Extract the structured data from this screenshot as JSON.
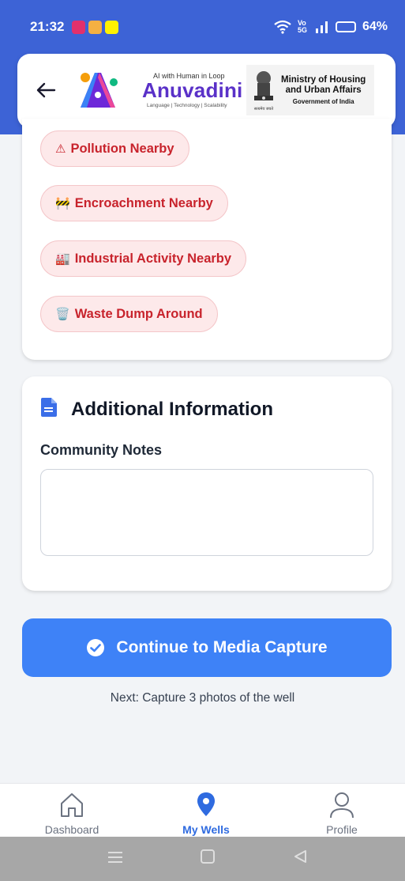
{
  "status_bar": {
    "time": "21:32",
    "apps": [
      "instagram-icon",
      "box-icon",
      "snapchat-icon"
    ],
    "network": "Vo 5G",
    "battery": "64%"
  },
  "header": {
    "back_icon": "arrow-left-icon",
    "brand_tagline": "AI with Human in Loop",
    "brand_name": "Anuvadini",
    "brand_sub": "Language | Technology | Scalability",
    "ministry_line1": "Ministry of Housing",
    "ministry_line2": "and Urban Affairs",
    "ministry_line3": "Government of India",
    "emblem_caption": "सत्यमेव जयते"
  },
  "issues": [
    {
      "icon": "⚠",
      "label": "Pollution Nearby"
    },
    {
      "icon": "🚧",
      "label": "Encroachment Nearby"
    },
    {
      "icon": "🏭",
      "label": "Industrial Activity Nearby"
    },
    {
      "icon": "🗑️",
      "label": "Waste Dump Around"
    }
  ],
  "additional": {
    "title": "Additional Information",
    "notes_label": "Community Notes",
    "notes_value": ""
  },
  "cta": {
    "label": "Continue to Media Capture",
    "hint": "Next: Capture 3 photos of the well"
  },
  "nav": {
    "items": [
      {
        "label": "Dashboard",
        "icon": "home-icon"
      },
      {
        "label": "My Wells",
        "icon": "location-pin-icon",
        "active": true
      },
      {
        "label": "Profile",
        "icon": "user-icon"
      }
    ]
  },
  "colors": {
    "header_blue": "#3d63d6",
    "accent_blue": "#3e82f7",
    "chip_red": "#c8232c",
    "chip_bg": "#fde9ea"
  }
}
